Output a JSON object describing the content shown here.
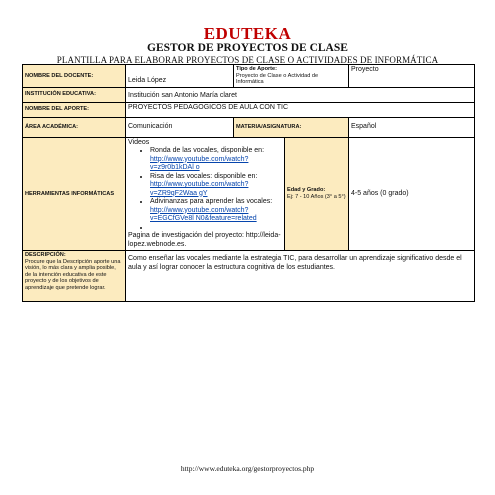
{
  "header": {
    "title": "EDUTEKA",
    "subtitle": "GESTOR DE PROYECTOS DE CLASE",
    "subtitle2": "PLANTILLA PARA ELABORAR PROYECTOS DE CLASE O ACTIVIDADES DE INFORMÁTICA"
  },
  "rows": {
    "docente_label": "NOMBRE DEL DOCENTE:",
    "docente_value": "Leida López",
    "tipo_label": "Tipo de Aporte:",
    "tipo_desc": "Proyecto de Clase o Actividad de Informática",
    "tipo_value": "Proyecto",
    "institucion_label": "INSTITUCIÓN EDUCATIVA:",
    "institucion_value": "Institución san Antonio María claret",
    "aporte_label": "NOMBRE DEL APORTE:",
    "aporte_value": "PROYECTOS PEDAGOGICOS DE AULA CON TIC",
    "area_label": "ÁREA ACADÉMICA:",
    "area_value": "Comunicación",
    "materia_label": "MATERIA/ASIGNATURA:",
    "materia_value": "Español",
    "herramientas_label": "HERRAMIENTAS INFORMÁTICAS",
    "videos_heading": "Videos",
    "video_items": [
      {
        "text": "Ronda de las vocales, disponible en:",
        "link": "http://www.youtube.com/watch?v=z9r0b1kDAl o"
      },
      {
        "text": "Risa de las vocales: disponible en:",
        "link": "http://www.youtube.com/watch?v=ZR9qF2Waa gY"
      },
      {
        "text": "Adivinanzas para aprender las vocales:",
        "link": "http://www.youtube.com/watch?v=EGCfGVe8l N0&feature=related"
      }
    ],
    "pagina_text": "Pagina de investigación del proyecto: http://leida-lopez.webnode.es.",
    "edad_label": "Edad y Grado:",
    "edad_desc": "Ej: 7 - 10 Años (3° a 5°)",
    "edad_value": "4-5 años (0 grado)",
    "descripcion_label": "DESCRIPCIÓN:",
    "descripcion_help": "Procure que la Descripción aporte una visión, lo más clara y amplia posible, de la intención educativa de este proyecto y de los objetivos de aprendizaje que pretende lograr.",
    "descripcion_value": "Como enseñar las vocales mediante la estrategia TIC, para desarrollar un aprendizaje significativo desde el aula y así lograr conocer la estructura cognitiva de los estudiantes."
  },
  "footer": {
    "url": "http://www.eduteka.org/gestorproyectos.php"
  }
}
